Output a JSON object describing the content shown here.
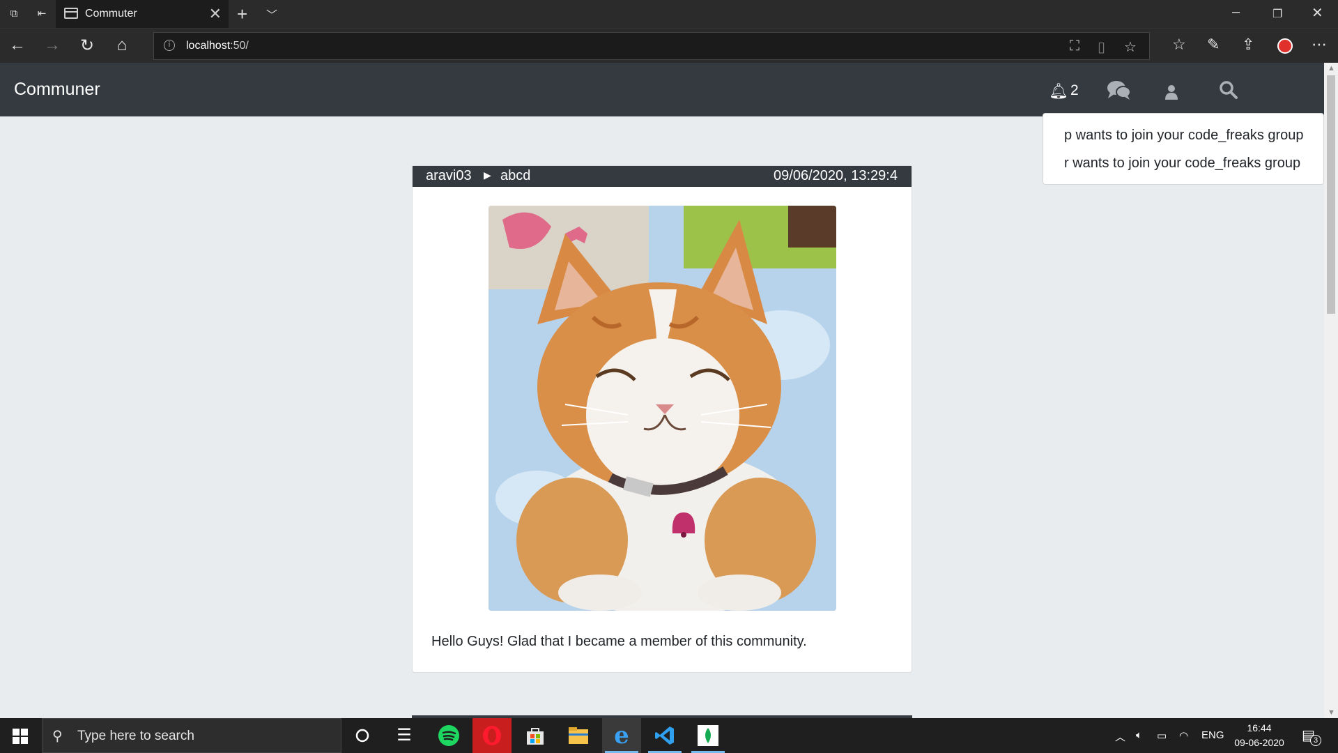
{
  "browser": {
    "tab_title": "Commuter",
    "url_host": "localhost",
    "url_rest": ":50/"
  },
  "app": {
    "brand": "Communer",
    "notification_count": "2"
  },
  "notifications": [
    "p wants to join your code_freaks group",
    "r wants to join your code_freaks group"
  ],
  "post": {
    "author": "aravi03",
    "group": "abcd",
    "timestamp": "09/06/2020, 13:29:4",
    "text": "Hello Guys! Glad that I became a member of this community."
  },
  "taskbar": {
    "search_placeholder": "Type here to search",
    "language": "ENG",
    "time": "16:44",
    "date": "09-06-2020",
    "notification_badge": "3"
  },
  "colors": {
    "app_navbar": "#343a40",
    "page_background": "#e9ecef",
    "browser_chrome": "#2b2b2b",
    "taskbar": "#1f1f1f"
  }
}
